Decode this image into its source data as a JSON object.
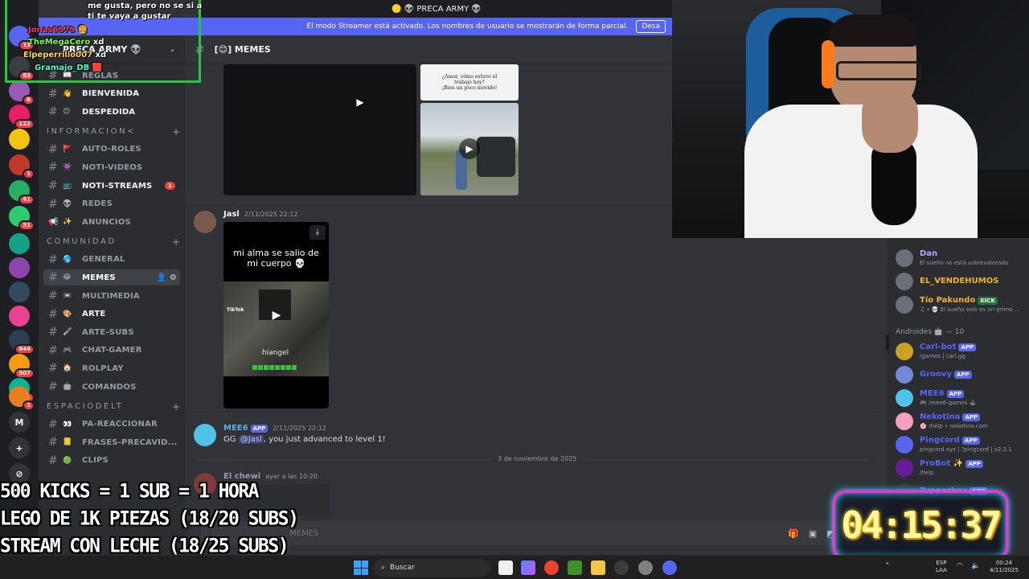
{
  "title_bar": {
    "server_title": "🟡 👽 PRECA ARMY 👽"
  },
  "streamer_banner": {
    "text": "El modo Streamer está activado. Los nombres de usuario se mostrarán de forma parcial.",
    "button": "Desa"
  },
  "server": {
    "name": "PRECA ARMY 👽"
  },
  "server_rail": {
    "items": [
      {
        "label": "",
        "badge": "13",
        "color": "#5865f2"
      },
      {
        "label": "",
        "badge": "83",
        "color": "#3a3d44"
      },
      {
        "label": "",
        "badge": "6",
        "color": "#9b59b6"
      },
      {
        "label": "",
        "badge": "122",
        "color": "#e91e63"
      },
      {
        "label": "",
        "badge": "",
        "color": "#f1c40f"
      },
      {
        "label": "",
        "badge": "1",
        "color": "#c0392b"
      },
      {
        "label": "",
        "badge": "41",
        "color": "#27ae60"
      },
      {
        "label": "",
        "badge": "31",
        "color": "#2ecc71"
      },
      {
        "label": "",
        "badge": "",
        "color": "#16a085"
      },
      {
        "label": "",
        "badge": "",
        "color": "#8e44ad"
      },
      {
        "label": "",
        "badge": "",
        "color": "#34495e"
      },
      {
        "label": "",
        "badge": "",
        "color": "#e84393"
      },
      {
        "label": "",
        "badge": "644",
        "color": "#2c3e50"
      },
      {
        "label": "",
        "badge": "507",
        "color": "#f39c12"
      },
      {
        "label": "",
        "badge": "1K+",
        "color": "#00b894"
      },
      {
        "label": "",
        "badge": "1",
        "color": "#e67e22"
      },
      {
        "label": "M",
        "badge": "",
        "color": "#313338"
      },
      {
        "label": "+",
        "badge": "",
        "color": "#313338"
      },
      {
        "label": "⊘",
        "badge": "",
        "color": "#313338"
      }
    ]
  },
  "channels": [
    {
      "emoji": "📖",
      "name": "REGLAS",
      "unread": false
    },
    {
      "emoji": "👋",
      "name": "BIENVENIDA",
      "unread": true
    },
    {
      "emoji": "😊",
      "name": "DESPEDIDA",
      "unread": true
    },
    {
      "category": "INFORMACION<",
      "plus": "+"
    },
    {
      "emoji": "🚩",
      "name": "AUTO-ROLES",
      "unread": false
    },
    {
      "emoji": "👾",
      "name": "NOTI-VIDEOS",
      "unread": false
    },
    {
      "emoji": "📺",
      "name": "NOTI-STREAMS",
      "unread": true,
      "badge": "1"
    },
    {
      "emoji": "👽",
      "name": "REDES",
      "unread": false
    },
    {
      "emoji": "✨",
      "name": "ANUNCIOS",
      "unread": false,
      "icon": "megaphone"
    },
    {
      "category": "COMUNIDAD",
      "plus": "+"
    },
    {
      "emoji": "🌎",
      "name": "GENERAL",
      "unread": false
    },
    {
      "emoji": "😂",
      "name": "MEMES",
      "unread": false,
      "active": true
    },
    {
      "emoji": "📼",
      "name": "MULTIMEDIA",
      "unread": false
    },
    {
      "emoji": "🎨",
      "name": "ARTE",
      "unread": true
    },
    {
      "emoji": "🖌",
      "name": "ARTE-SUBS",
      "unread": false
    },
    {
      "emoji": "🎮",
      "name": "CHAT-GAMER",
      "unread": false
    },
    {
      "emoji": "🏠",
      "name": "ROLPLAY",
      "unread": false
    },
    {
      "emoji": "🤖",
      "name": "COMANDOS",
      "unread": false
    },
    {
      "category": "ESPACIODELT",
      "plus": "+"
    },
    {
      "emoji": "👀",
      "name": "PA-REACCIONAR",
      "unread": false
    },
    {
      "emoji": "📒",
      "name": "FRASES-PRECAVID...",
      "unread": false
    },
    {
      "emoji": "🟢",
      "name": "CLIPS",
      "unread": false
    }
  ],
  "channel_header": {
    "name": "[😊] MEMES"
  },
  "messages": {
    "top_image_caption_1": "¿Amor, cómo estuvo el",
    "top_image_caption_2": "trabajo hoy?",
    "top_image_caption_3": "¡Bien un poco movido!",
    "jasl": {
      "author": "Jasl",
      "time": "2/11/2025 22:12",
      "video_caption": "mi alma se salio de mi cuerpo 💀",
      "tiktok": "TikTok",
      "watermark": "hiangel"
    },
    "mee6": {
      "author": "MEE6",
      "tag": "APP",
      "time": "2/11/2025 22:12",
      "text_pre": "GG ",
      "mention": "@Jasl",
      "text_post": ", you just advanced to level 1!"
    },
    "date_divider": "3 de noviembre de 2025",
    "chewi": {
      "author": "El chewi",
      "time": "ayer a las 10:20"
    }
  },
  "composer": {
    "placeholder": "MEMES"
  },
  "members": {
    "top": [
      {
        "name": "Dan",
        "status": "El sueño no está sobrevalorado",
        "color": "#b9a3ff"
      },
      {
        "name": "EL_VENDEHUMOS",
        "status": "",
        "color": "#f0b232"
      },
      {
        "name": "Tío Pakundo",
        "status": "♫ • 💀 El sueño solo es un primo ...",
        "color": "#f0b232",
        "tag": "KICK"
      }
    ],
    "role_header": "Androides 🤖 — 10",
    "bots": [
      {
        "name": "Carl-bot",
        "status": "/games | carl.gg",
        "color": "#5865f2"
      },
      {
        "name": "Groovy",
        "status": "",
        "color": "#5865f2"
      },
      {
        "name": "MEE6",
        "status": "🎮 /mee6-games 🕹",
        "color": "#5865f2"
      },
      {
        "name": "Nekotina",
        "status": "🌸 !help • nekotina.com",
        "color": "#5865f2"
      },
      {
        "name": "Pingcord",
        "status": "pingcord.xyz | ?pingcord | v2.2.1",
        "color": "#5865f2"
      },
      {
        "name": "ProBot ✨",
        "status": "/help",
        "color": "#5865f2"
      },
      {
        "name": "Tupperbox",
        "status": "",
        "color": "#5865f2"
      }
    ],
    "app_tag": "APP"
  },
  "overlay_chat": [
    {
      "user": "",
      "text": "me gusta, pero no se si a",
      "color": "#ffffff"
    },
    {
      "user": "",
      "text": "ti te vaya a gustar",
      "color": "#ffffff"
    },
    {
      "user": "Jonas6575",
      "text": "🍔",
      "color": "#ff3b5c"
    },
    {
      "user": "TheMegaCero",
      "text": "xd",
      "color": "#7dff4a"
    },
    {
      "user": "Elpeperrillo007",
      "text": "xd",
      "color": "#ffd84a"
    },
    {
      "user": "Gramajo_DB",
      "text": "🟥",
      "color": "#4affc9"
    }
  ],
  "stream_goals": [
    "500 KICKS = 1 SUB = 1 HORA",
    "LEGO DE 1K PIEZAS (18/20 SUBS)",
    "STREAM CON LECHE (18/25 SUBS)"
  ],
  "timer": "04:15:37",
  "taskbar": {
    "search": "Buscar",
    "lang_1": "ESP",
    "lang_2": "LAA",
    "time": "00:24",
    "date": "4/11/2025"
  },
  "colors": {
    "blurple": "#5865f2",
    "danger": "#f23f43",
    "overlay_green": "#22c93a"
  }
}
